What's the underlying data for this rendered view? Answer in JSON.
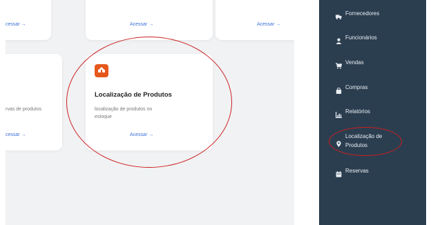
{
  "cards": {
    "top_left_link": "cessar →",
    "top_middle_link": "Acessar →",
    "top_right_link": "Acessar →",
    "bottom_left_desc": "rvas de produtos",
    "bottom_left_link": "cessar →",
    "featured": {
      "title": "Localização de Produtos",
      "description_line1": "localização de produtos no",
      "description_line2": "estoque",
      "link": "Acessar →"
    }
  },
  "sidebar": {
    "items": [
      {
        "label": "Fornecedores",
        "icon": "truck-icon"
      },
      {
        "label": "Funcionários",
        "icon": "user-icon"
      },
      {
        "label": "Vendas",
        "icon": "cart-icon"
      },
      {
        "label": "Compras",
        "icon": "shopping-bag-icon"
      },
      {
        "label": "Relatórios",
        "icon": "chart-icon"
      },
      {
        "label_line1": "Localização de",
        "label_line2": "Produtos",
        "icon": "map-pin-icon"
      },
      {
        "label": "Reservas",
        "icon": "calendar-icon"
      }
    ]
  },
  "colors": {
    "sidebar_bg": "#2b3e50",
    "accent_orange": "#e6571b",
    "link_blue": "#3a6fd8",
    "highlight_red": "#cc1e1e"
  }
}
